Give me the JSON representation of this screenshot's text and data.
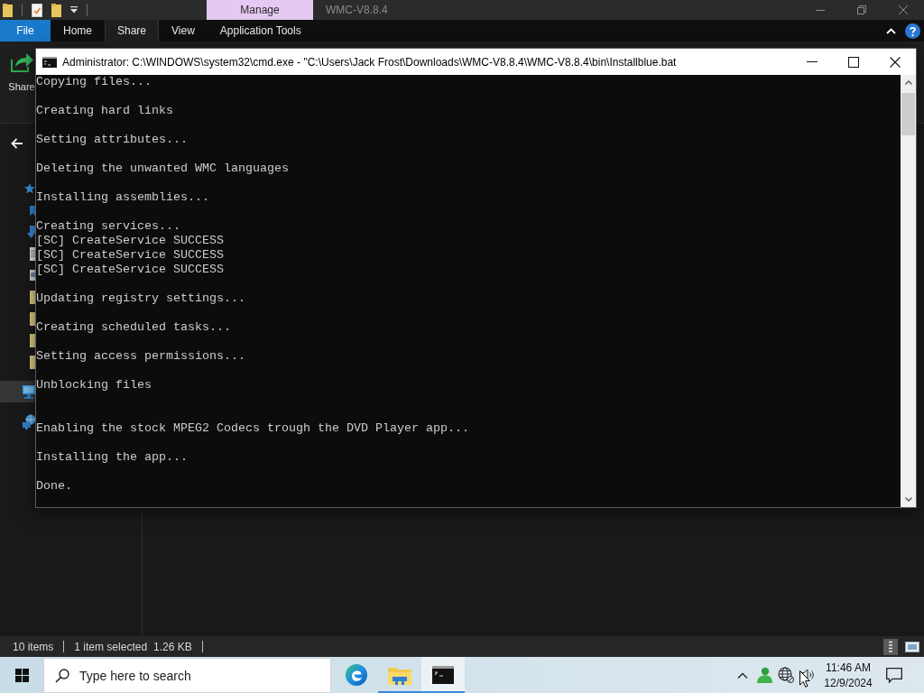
{
  "explorer": {
    "context_tab": "Manage",
    "title": "WMC-V8.8.4",
    "ribbon_tabs": [
      {
        "label": "File",
        "kind": "file",
        "selected": false
      },
      {
        "label": "Home",
        "kind": "tab",
        "selected": false
      },
      {
        "label": "Share",
        "kind": "tab",
        "selected": true
      },
      {
        "label": "View",
        "kind": "tab",
        "selected": false
      },
      {
        "label": "Application Tools",
        "kind": "tab",
        "selected": false
      }
    ],
    "ribbon_button": "Share",
    "nav_items": [
      {
        "kind": "quick_access",
        "selected": false
      },
      {
        "kind": "desktop",
        "selected": false
      },
      {
        "kind": "downloads",
        "selected": false
      },
      {
        "kind": "documents",
        "selected": false
      },
      {
        "kind": "pictures",
        "selected": false
      },
      {
        "kind": "folder",
        "selected": false
      },
      {
        "kind": "folder",
        "selected": false
      },
      {
        "kind": "folder",
        "selected": false
      },
      {
        "kind": "folder",
        "selected": false
      },
      {
        "kind": "this_pc",
        "selected": true
      },
      {
        "kind": "network",
        "selected": false
      }
    ],
    "status_bar": {
      "item_count": "10 items",
      "selection": "1 item selected",
      "size": "1.26 KB",
      "view_buttons": [
        {
          "kind": "details",
          "selected": true
        },
        {
          "kind": "large_icons",
          "selected": false
        }
      ]
    }
  },
  "console_window": {
    "title": "Administrator: C:\\WINDOWS\\system32\\cmd.exe - \"C:\\Users\\Jack Frost\\Downloads\\WMC-V8.8.4\\WMC-V8.8.4\\bin\\Installblue.bat",
    "blocks": [
      {
        "kind": "first",
        "lines": [
          "Copying files..."
        ]
      },
      {
        "kind": "step",
        "lines": [
          "Creating hard links"
        ]
      },
      {
        "kind": "step",
        "lines": [
          "Setting attributes..."
        ]
      },
      {
        "kind": "step",
        "lines": [
          "Deleting the unwanted WMC languages"
        ]
      },
      {
        "kind": "step",
        "lines": [
          "Installing assemblies..."
        ]
      },
      {
        "kind": "step",
        "lines": [
          "Creating services...",
          "[SC] CreateService SUCCESS",
          "[SC] CreateService SUCCESS",
          "[SC] CreateService SUCCESS"
        ]
      },
      {
        "kind": "step",
        "lines": [
          "Updating registry settings..."
        ]
      },
      {
        "kind": "step",
        "lines": [
          "Creating scheduled tasks..."
        ]
      },
      {
        "kind": "step",
        "lines": [
          "Setting access permissions..."
        ]
      },
      {
        "kind": "step",
        "lines": [
          "Unblocking files"
        ]
      },
      {
        "kind": "spaced",
        "lines": [
          "Enabling the stock MPEG2 Codecs trough the DVD Player app..."
        ]
      },
      {
        "kind": "step",
        "lines": [
          "Installing the app..."
        ]
      },
      {
        "kind": "step",
        "lines": [
          "Done."
        ]
      }
    ]
  },
  "taskbar": {
    "search": {
      "placeholder": "Type here to search"
    },
    "apps": [
      {
        "kind": "browser",
        "running": false,
        "selected": false
      },
      {
        "kind": "file_manager",
        "running": true,
        "selected": false
      },
      {
        "kind": "terminal",
        "running": true,
        "selected": true
      }
    ],
    "clock": {
      "time": "11:46 AM",
      "date": "12/9/2024"
    }
  }
}
